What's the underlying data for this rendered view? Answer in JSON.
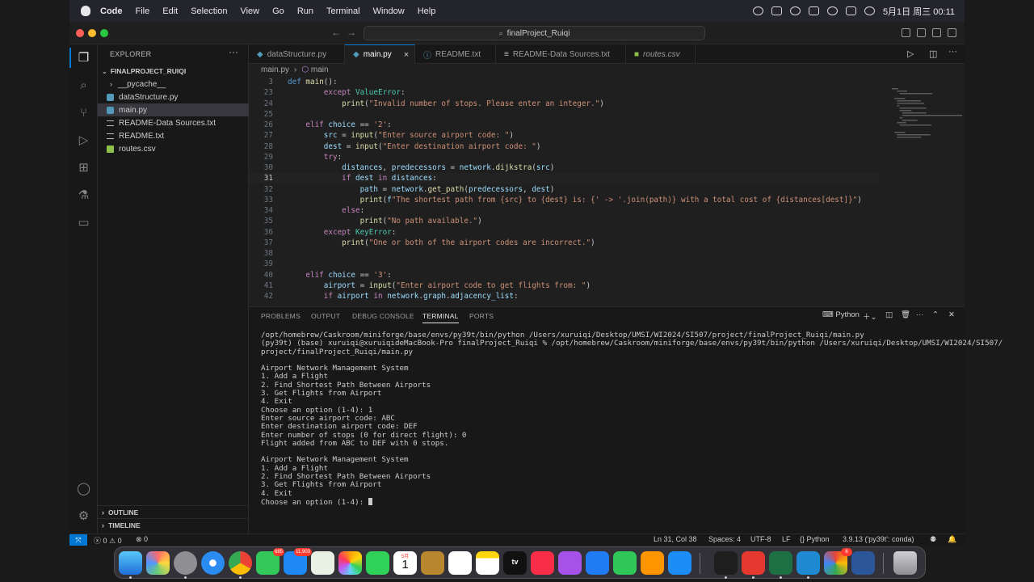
{
  "menubar": {
    "app": "Code",
    "menus": [
      "File",
      "Edit",
      "Selection",
      "View",
      "Go",
      "Run",
      "Terminal",
      "Window",
      "Help"
    ],
    "clock": "5月1日 周三  00:11"
  },
  "window": {
    "search_text": "finalProject_Ruiqi"
  },
  "explorer": {
    "title": "EXPLORER",
    "more": "···",
    "folder": "FINALPROJECT_RUIQI",
    "items": [
      {
        "label": "__pycache__",
        "type": "folder"
      },
      {
        "label": "dataStructure.py",
        "type": "python"
      },
      {
        "label": "main.py",
        "type": "python"
      },
      {
        "label": "README-Data Sources.txt",
        "type": "text"
      },
      {
        "label": "README.txt",
        "type": "text"
      },
      {
        "label": "routes.csv",
        "type": "csv"
      }
    ],
    "outline": "OUTLINE",
    "timeline": "TIMELINE"
  },
  "tabs": [
    {
      "label": "dataStructure.py",
      "icon": "python-file-icon"
    },
    {
      "label": "main.py",
      "icon": "python-file-icon",
      "close": "×"
    },
    {
      "label": "README.txt",
      "icon": "info-icon"
    },
    {
      "label": "README-Data Sources.txt",
      "icon": "text-file-icon"
    },
    {
      "label": "routes.csv",
      "icon": "csv-file-icon"
    }
  ],
  "breadcrumb": {
    "file": "main.py",
    "separator": "›",
    "symbol": "main"
  },
  "code": {
    "current_line": "31",
    "lines": [
      {
        "n": "3",
        "text": "def main():"
      },
      {
        "n": "23",
        "text": "        except ValueError:"
      },
      {
        "n": "24",
        "text": "            print(\"Invalid number of stops. Please enter an integer.\")"
      },
      {
        "n": "25",
        "text": ""
      },
      {
        "n": "26",
        "text": "    elif choice == '2':"
      },
      {
        "n": "27",
        "text": "        src = input(\"Enter source airport code: \")"
      },
      {
        "n": "28",
        "text": "        dest = input(\"Enter destination airport code: \")"
      },
      {
        "n": "29",
        "text": "        try:"
      },
      {
        "n": "30",
        "text": "            distances, predecessors = network.dijkstra(src)"
      },
      {
        "n": "31",
        "text": "            if dest in distances:"
      },
      {
        "n": "32",
        "text": "                path = network.get_path(predecessors, dest)"
      },
      {
        "n": "33",
        "text": "                print(f\"The shortest path from {src} to {dest} is: {' -> '.join(path)} with a total cost of {distances[dest]}\")"
      },
      {
        "n": "34",
        "text": "            else:"
      },
      {
        "n": "35",
        "text": "                print(\"No path available.\")"
      },
      {
        "n": "36",
        "text": "        except KeyError:"
      },
      {
        "n": "37",
        "text": "            print(\"One or both of the airport codes are incorrect.\")"
      },
      {
        "n": "38",
        "text": ""
      },
      {
        "n": "39",
        "text": ""
      },
      {
        "n": "40",
        "text": "    elif choice == '3':"
      },
      {
        "n": "41",
        "text": "        airport = input(\"Enter airport code to get flights from: \")"
      },
      {
        "n": "42",
        "text": "        if airport in network.graph.adjacency_list:"
      }
    ]
  },
  "panel": {
    "tabs": [
      "PROBLEMS",
      "OUTPUT",
      "DEBUG CONSOLE",
      "TERMINAL",
      "PORTS"
    ],
    "active_tab": "TERMINAL",
    "terminal_name": "Python",
    "terminal_lines": [
      "/opt/homebrew/Caskroom/miniforge/base/envs/py39t/bin/python /Users/xuruiqi/Desktop/UMSI/WI2024/SI507/project/finalProject_Ruiqi/main.py",
      "(py39t) (base) xuruiqi@xuruiqideMacBook-Pro finalProject_Ruiqi % /opt/homebrew/Caskroom/miniforge/base/envs/py39t/bin/python /Users/xuruiqi/Desktop/UMSI/WI2024/SI507/",
      "project/finalProject_Ruiqi/main.py",
      "",
      "Airport Network Management System",
      "1. Add a Flight",
      "2. Find Shortest Path Between Airports",
      "3. Get Flights from Airport",
      "4. Exit",
      "Choose an option (1-4): 1",
      "Enter source airport code: ABC",
      "Enter destination airport code: DEF",
      "Enter number of stops (0 for direct flight): 0",
      "Flight added from ABC to DEF with 0 stops.",
      "",
      "Airport Network Management System",
      "1. Add a Flight",
      "2. Find Shortest Path Between Airports",
      "3. Get Flights from Airport",
      "4. Exit",
      "Choose an option (1-4): "
    ]
  },
  "status": {
    "errors": "0",
    "warnings": "0",
    "ports": "0",
    "position": "Ln 31, Col 38",
    "spaces": "Spaces: 4",
    "encoding": "UTF-8",
    "eol": "LF",
    "language": "Python",
    "interpreter": "3.9.13 ('py39t': conda)"
  },
  "dock": {
    "messages_badge": "685",
    "mail_badge": "11,903",
    "calendar_month": "5月",
    "calendar_day": "1",
    "tv_label": "tv",
    "office_badge": "6"
  },
  "colors": {
    "accent": "#0078d4",
    "editor_bg": "#1f1f1f",
    "sidebar_bg": "#181818",
    "python_icon": "#519aba",
    "csv_icon": "#8dc149"
  }
}
